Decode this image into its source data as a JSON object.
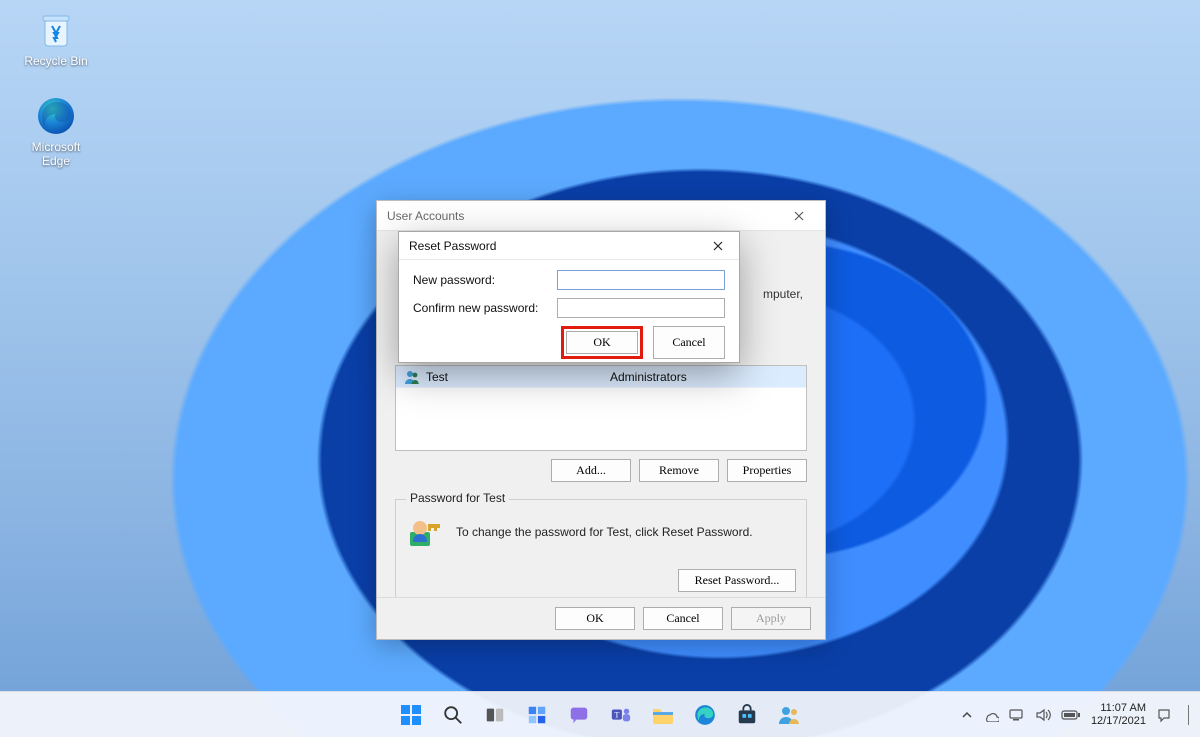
{
  "desktop_icons": [
    {
      "name": "recycle-bin",
      "label": "Recycle Bin"
    },
    {
      "name": "microsoft-edge",
      "label": "Microsoft Edge"
    }
  ],
  "user_accounts_window": {
    "title": "User Accounts",
    "hint_fragment": "mputer,",
    "users": [
      {
        "name": "Test",
        "group": "Administrators"
      }
    ],
    "buttons": {
      "add": "Add...",
      "remove": "Remove",
      "properties": "Properties"
    },
    "password_box": {
      "legend": "Password for Test",
      "text": "To change the password for Test, click Reset Password.",
      "reset_button": "Reset Password..."
    },
    "bottom": {
      "ok": "OK",
      "cancel": "Cancel",
      "apply": "Apply"
    }
  },
  "reset_password_dialog": {
    "title": "Reset Password",
    "new_password_label": "New password:",
    "confirm_label": "Confirm new password:",
    "new_password_value": "",
    "confirm_value": "",
    "ok": "OK",
    "cancel": "Cancel"
  },
  "taskbar": {
    "center_items": [
      "start",
      "search",
      "task-view",
      "widgets",
      "chat",
      "teams",
      "file-explorer",
      "edge",
      "store",
      "user-accounts"
    ]
  },
  "tray": {
    "time": "11:07 AM",
    "date": "12/17/2021"
  }
}
